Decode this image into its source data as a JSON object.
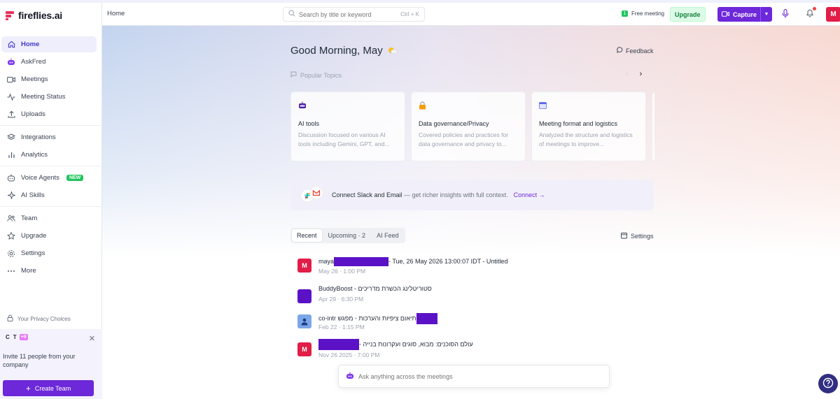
{
  "app": {
    "brand": "fireflies.ai",
    "accent": "#6d28d9",
    "brand_color": "#e8315b"
  },
  "sidebar": {
    "items": [
      {
        "label": "Home",
        "icon": "home-icon"
      },
      {
        "label": "AskFred",
        "icon": "askfred-icon"
      },
      {
        "label": "Meetings",
        "icon": "video-icon"
      },
      {
        "label": "Meeting Status",
        "icon": "activity-icon"
      },
      {
        "label": "Uploads",
        "icon": "upload-icon"
      },
      {
        "label": "Integrations",
        "icon": "layers-icon"
      },
      {
        "label": "Analytics",
        "icon": "bar-chart-icon"
      },
      {
        "label": "Voice Agents",
        "icon": "voice-agent-icon",
        "badge": "NEW"
      },
      {
        "label": "AI Skills",
        "icon": "sparkle-icon"
      },
      {
        "label": "Team",
        "icon": "users-icon"
      },
      {
        "label": "Upgrade",
        "icon": "star-icon"
      },
      {
        "label": "Settings",
        "icon": "gear-icon"
      },
      {
        "label": "More",
        "icon": "more-icon"
      }
    ],
    "privacy": "Your Privacy Choices",
    "invite": {
      "avatars": [
        "C",
        "T"
      ],
      "extra": "+9",
      "text": "Invite 11 people from your company",
      "button": "Create Team"
    }
  },
  "topbar": {
    "breadcrumb": "Home",
    "search_placeholder": "Search by title or keyword",
    "shortcut": "Ctrl + K",
    "free_meeting_count": "1",
    "free_meeting_label": "Free meeting",
    "upgrade": "Upgrade",
    "capture": "Capture",
    "user_initial": "M"
  },
  "main": {
    "greeting": "Good Morning, May",
    "feedback": "Feedback",
    "popular_label": "Popular Topics",
    "topics": [
      {
        "title": "AI tools",
        "desc": "Discussion focused on various AI tools including Gemini, GPT, and...",
        "icon": "robot-icon"
      },
      {
        "title": "Data governance/Privacy",
        "desc": "Covered policies and practices for data governance and privacy to...",
        "icon": "lock-icon"
      },
      {
        "title": "Meeting format and logistics",
        "desc": "Analyzed the structure and logistics of meetings to improve...",
        "icon": "calendar-icon"
      }
    ],
    "connect": {
      "title": "Connect Slack and Email",
      "sub": " — get richer insights with full context.",
      "link": "Connect →"
    },
    "tabs": [
      "Recent",
      "Upcoming · 2",
      "AI Feed"
    ],
    "settings": "Settings",
    "meetings": [
      {
        "title_pre": "maya",
        "title_post": "- Tue, 26 May 2026 13:00:07 IDT - Untitled",
        "meta": "May 26 · 1:00 PM",
        "avatar": "M",
        "avatar_color": "#e11d48"
      },
      {
        "title": "BuddyBoost - סטוריטלינג הכשרת מדריכים",
        "meta": "Apr 29 · 6:30 PM",
        "avatar": "",
        "avatar_color": "#5b12c7"
      },
      {
        "title": "co-intr תיאום ציפיות והערכות - מפגש",
        "meta": "Feb 22 · 1:15 PM",
        "avatar": "",
        "avatar_color": "#7ba7e6"
      },
      {
        "title": "- עולם הסוכנים: מבוא, סוגים ועקרונות בנייה",
        "meta": "Nov 26 2025 · 7:00 PM",
        "avatar": "M",
        "avatar_color": "#e11d48"
      }
    ],
    "ask_placeholder": "Ask anything across the meetings"
  }
}
